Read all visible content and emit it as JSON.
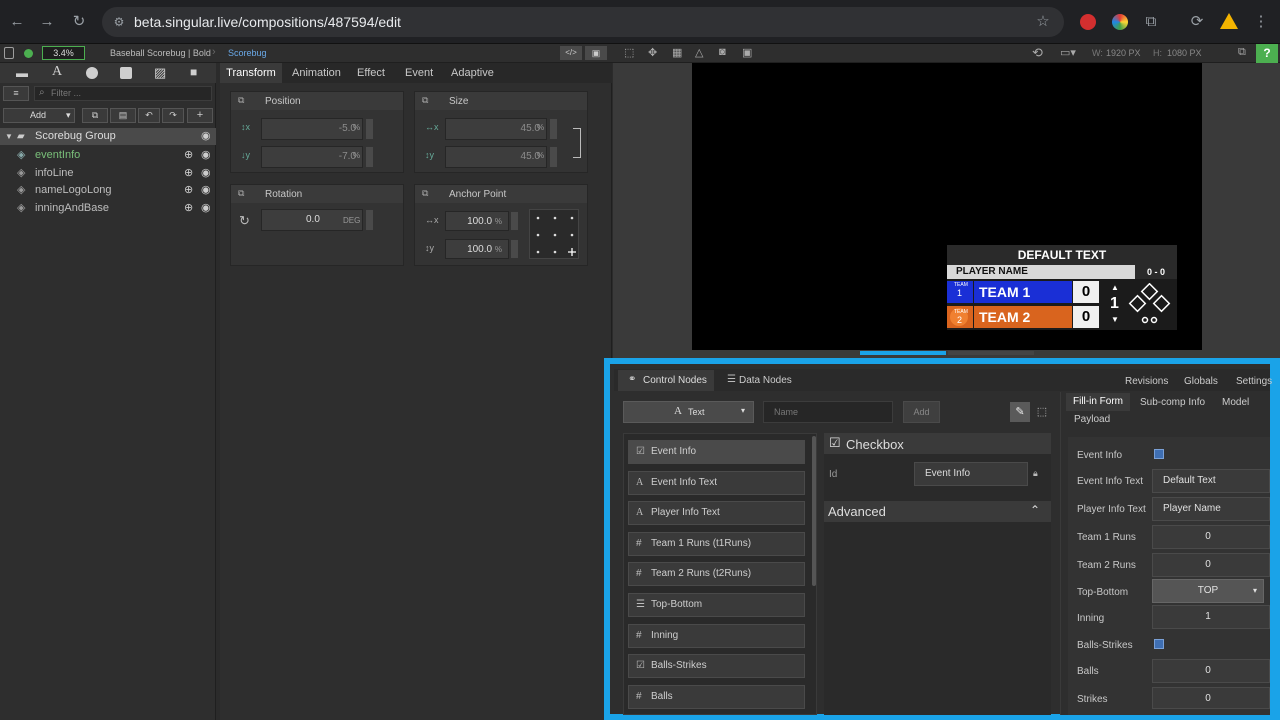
{
  "browser": {
    "url": "beta.singular.live/compositions/487594/edit"
  },
  "toolbar": {
    "zoom": "3.4%",
    "breadcrumb_1": "Baseball Scorebug | Bold",
    "breadcrumb_2": "Scorebug",
    "width_label": "W:",
    "width_value": "1920 PX",
    "height_label": "H:",
    "height_value": "1080 PX"
  },
  "layers": {
    "add_label": "Add",
    "filter_placeholder": "Filter ...",
    "group": "Scorebug Group",
    "items": [
      "eventInfo",
      "infoLine",
      "nameLogoLong",
      "inningAndBase"
    ]
  },
  "inspector": {
    "tabs": [
      "Transform",
      "Animation",
      "Effect",
      "Event",
      "Adaptive"
    ],
    "position": {
      "title": "Position",
      "x": "-5.0",
      "y": "-7.0",
      "unit": "%"
    },
    "size": {
      "title": "Size",
      "x": "45.0",
      "y": "45.0",
      "unit": "%"
    },
    "rotation": {
      "title": "Rotation",
      "value": "0.0",
      "unit": "DEG"
    },
    "anchor": {
      "title": "Anchor Point",
      "x": "100.0",
      "y": "100.0",
      "unit": "%"
    }
  },
  "scorebug": {
    "title": "DEFAULT TEXT",
    "player": "PLAYER NAME",
    "count": "0 - 0",
    "team1": "TEAM 1",
    "team1_score": "0",
    "team1_badge": "1",
    "team1_badge_label": "TEAM",
    "team2": "TEAM 2",
    "team2_score": "0",
    "team2_badge": "2",
    "team2_badge_label": "TEAM",
    "inning": "1"
  },
  "bottom": {
    "tabs": [
      "Control Nodes",
      "Data Nodes"
    ],
    "right_tabs": [
      "Revisions",
      "Globals",
      "Settings"
    ],
    "type_select": "Text",
    "name_placeholder": "Name",
    "add_label": "Add",
    "nodes": [
      {
        "icon": "checkbox",
        "label": "Event Info"
      },
      {
        "icon": "text",
        "label": "Event Info Text"
      },
      {
        "icon": "text",
        "label": "Player Info Text"
      },
      {
        "icon": "number",
        "label": "Team 1 Runs (t1Runs)"
      },
      {
        "icon": "number",
        "label": "Team 2 Runs (t2Runs)"
      },
      {
        "icon": "list",
        "label": "Top-Bottom"
      },
      {
        "icon": "number",
        "label": "Inning"
      },
      {
        "icon": "checkbox",
        "label": "Balls-Strikes"
      },
      {
        "icon": "number",
        "label": "Balls"
      }
    ],
    "detail": {
      "type": "Checkbox",
      "id_label": "Id",
      "id_value": "Event Info",
      "advanced": "Advanced"
    },
    "form_tabs": [
      "Fill-in Form",
      "Sub-comp Info",
      "Model",
      "Payload"
    ],
    "form": [
      {
        "label": "Event Info",
        "kind": "checkbox"
      },
      {
        "label": "Event Info Text",
        "value": "Default Text"
      },
      {
        "label": "Player Info Text",
        "value": "Player Name"
      },
      {
        "label": "Team 1 Runs",
        "value": "0"
      },
      {
        "label": "Team 2 Runs",
        "value": "0"
      },
      {
        "label": "Top-Bottom",
        "value": "TOP"
      },
      {
        "label": "Inning",
        "value": "1"
      },
      {
        "label": "Balls-Strikes",
        "kind": "checkbox"
      },
      {
        "label": "Balls",
        "value": "0"
      },
      {
        "label": "Strikes",
        "value": "0"
      }
    ]
  },
  "colors": {
    "highlight_border": "#1aa3e8",
    "team1": "#1a2fd6",
    "team2": "#d9641e",
    "accent_green": "#4caf50"
  }
}
